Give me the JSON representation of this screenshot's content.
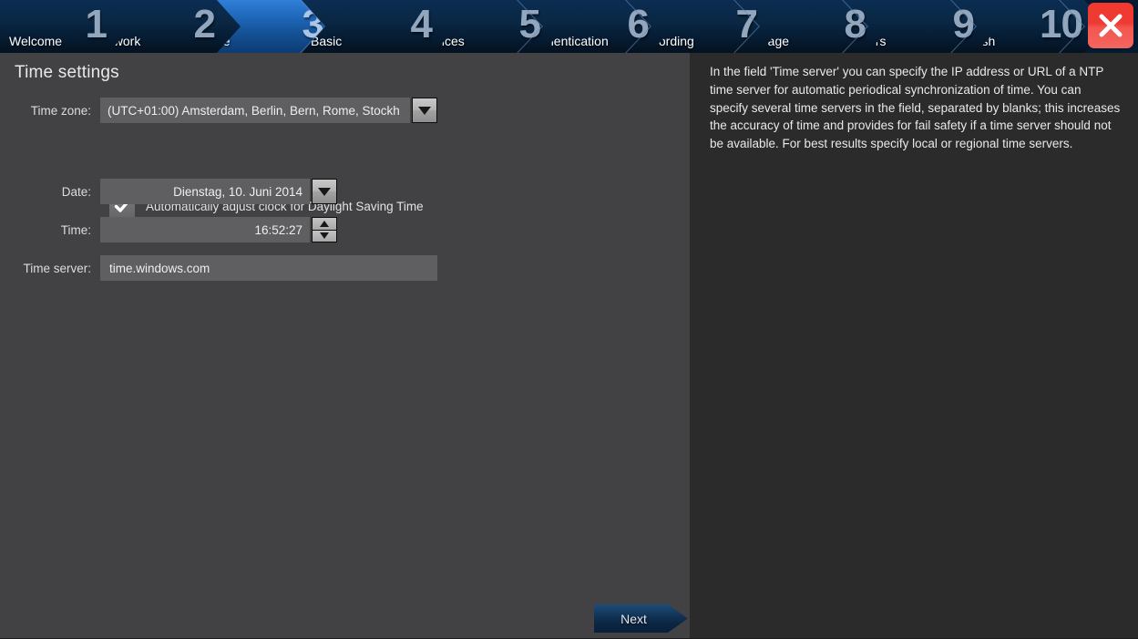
{
  "wizard": {
    "steps": [
      {
        "number": "1",
        "label": "Welcome",
        "active": false
      },
      {
        "number": "2",
        "label": "Network",
        "active": false
      },
      {
        "number": "3",
        "label": "Time",
        "active": true
      },
      {
        "number": "4",
        "label": "Basic",
        "active": false
      },
      {
        "number": "5",
        "label": "Devices",
        "active": false
      },
      {
        "number": "6",
        "label": "Authentication",
        "active": false
      },
      {
        "number": "7",
        "label": "Recording",
        "active": false
      },
      {
        "number": "8",
        "label": "Storage",
        "active": false
      },
      {
        "number": "9",
        "label": "Users",
        "active": false
      },
      {
        "number": "10",
        "label": "Finish",
        "active": false
      }
    ],
    "close_icon": "close-x-icon",
    "close_color": "#f0392f",
    "active_tab_color": "#2069bd",
    "tab_color": "#0a2845"
  },
  "main": {
    "title": "Time settings",
    "labels": {
      "time_zone": "Time zone:",
      "date": "Date:",
      "time": "Time:",
      "time_server": "Time server:"
    },
    "fields": {
      "time_zone_value": "(UTC+01:00) Amsterdam, Berlin, Bern, Rome, Stockh",
      "date_value": "Dienstag, 10. Juni 2014",
      "time_value": "16:52:27",
      "time_server_value": "time.windows.com",
      "time_server_placeholder": "time.windows.com"
    },
    "dst": {
      "label": "Automatically adjust clock for Daylight Saving Time",
      "checked": true,
      "check_icon": "check-icon"
    },
    "icons": {
      "dropdown": "chevron-down-icon",
      "spin_up": "chevron-up-icon",
      "spin_down": "chevron-down-icon"
    },
    "field_bg": "#5f5f61",
    "panel_bg": "#424244"
  },
  "footer": {
    "next_label": "Next",
    "next_icon": "arrow-right-icon"
  },
  "help": {
    "text": "In the field 'Time server' you can specify the IP address or URL of a NTP time server for automatic periodical synchronization of time. You can specify several time servers in the field, separated by blanks; this increases the accuracy of time and provides for fail safety if a time server should not be available. For best results specify local or regional time servers.",
    "panel_bg": "#2b2b2b"
  }
}
